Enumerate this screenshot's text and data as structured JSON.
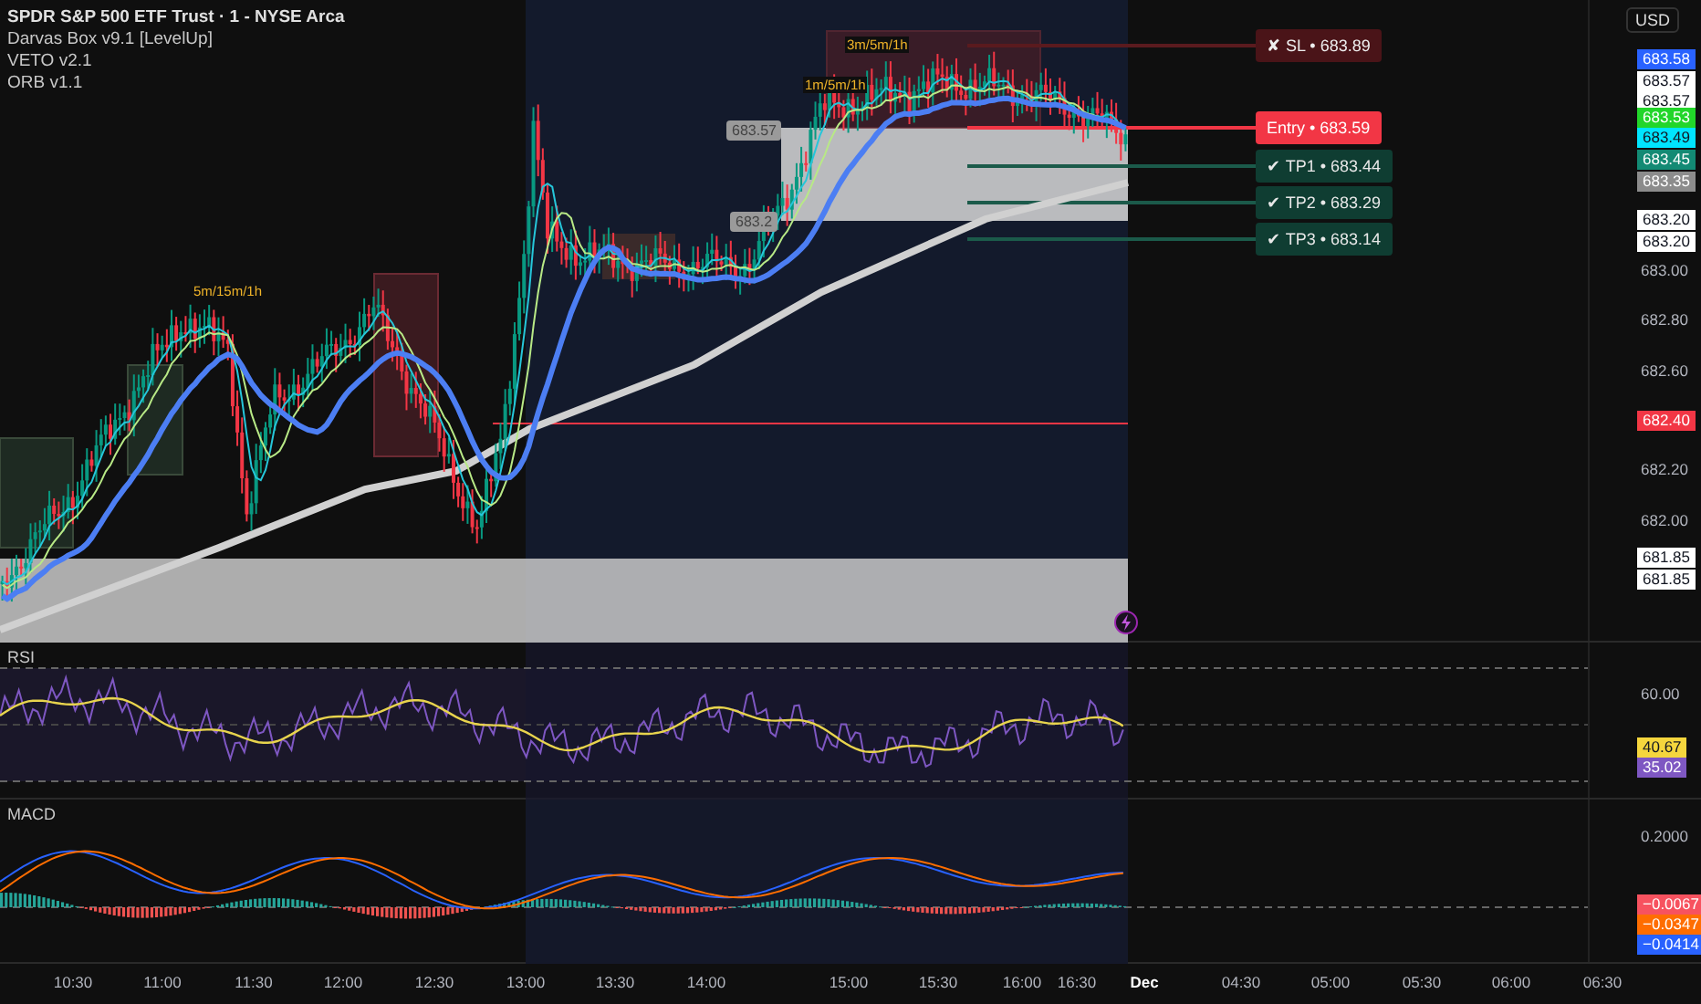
{
  "legend": {
    "symbol": "SPDR S&P 500 ETF Trust · 1 - NYSE Arca",
    "indicators": [
      "Darvas Box v9.1 [LevelUp]",
      "VETO v2.1",
      "ORB v1.1"
    ]
  },
  "chart_labels": [
    {
      "text": "5m/15m/1h"
    },
    {
      "text": "3m/5m/1h"
    },
    {
      "text": "1m/5m/1h"
    }
  ],
  "box_tags": [
    "683.57",
    "683.2"
  ],
  "trade_levels": [
    {
      "kind": "stop",
      "label": "✘ SL • 683.89"
    },
    {
      "kind": "entry",
      "label": "Entry • 683.59"
    },
    {
      "kind": "target",
      "label": "✔ TP1 • 683.44"
    },
    {
      "kind": "target",
      "label": "✔ TP2 • 683.29"
    },
    {
      "kind": "target",
      "label": "✔ TP3 • 683.14"
    }
  ],
  "price_axis": {
    "currency": "USD",
    "ticks": [
      "683.00",
      "682.80",
      "682.60",
      "682.20",
      "682.00"
    ],
    "tags": [
      {
        "text": "683.58",
        "color": "#2962ff"
      },
      {
        "text": "683.57",
        "color": "#ffffff"
      },
      {
        "text": "683.57",
        "color": "#ffffff"
      },
      {
        "text": "683.53",
        "color": "#22d62a"
      },
      {
        "text": "683.49",
        "color": "#00e5ff"
      },
      {
        "text": "683.45",
        "color": "#138a74"
      },
      {
        "text": "683.35",
        "color": "#8c8c8c"
      },
      {
        "text": "683.20",
        "color": "#ffffff"
      },
      {
        "text": "683.20",
        "color": "#ffffff"
      },
      {
        "text": "682.40",
        "color": "#f23645"
      },
      {
        "text": "681.85",
        "color": "#ffffff"
      },
      {
        "text": "681.85",
        "color": "#ffffff"
      }
    ]
  },
  "rsi": {
    "title": "RSI",
    "ticks": [
      "60.00"
    ],
    "tags": [
      {
        "text": "40.67",
        "color": "#f5d63d"
      },
      {
        "text": "35.02",
        "color": "#7e57c2"
      }
    ]
  },
  "macd": {
    "title": "MACD",
    "ticks": [
      "0.2000"
    ],
    "tags": [
      {
        "text": "−0.0067",
        "color": "#f7525f"
      },
      {
        "text": "−0.0347",
        "color": "#ff6d00"
      },
      {
        "text": "−0.0414",
        "color": "#2962ff"
      }
    ]
  },
  "time_axis": [
    {
      "text": "10:30",
      "kind": "time"
    },
    {
      "text": "11:00",
      "kind": "time"
    },
    {
      "text": "11:30",
      "kind": "time"
    },
    {
      "text": "12:00",
      "kind": "time"
    },
    {
      "text": "12:30",
      "kind": "time"
    },
    {
      "text": "13:00",
      "kind": "time"
    },
    {
      "text": "13:30",
      "kind": "time"
    },
    {
      "text": "14:00",
      "kind": "time"
    },
    {
      "text": "15:00",
      "kind": "time"
    },
    {
      "text": "15:30",
      "kind": "time"
    },
    {
      "text": "16:00",
      "kind": "time"
    },
    {
      "text": "16:30",
      "kind": "time"
    },
    {
      "text": "Dec",
      "kind": "date"
    },
    {
      "text": "04:30",
      "kind": "time"
    },
    {
      "text": "05:00",
      "kind": "time"
    },
    {
      "text": "05:30",
      "kind": "time"
    },
    {
      "text": "06:00",
      "kind": "time"
    },
    {
      "text": "06:30",
      "kind": "time"
    }
  ]
}
